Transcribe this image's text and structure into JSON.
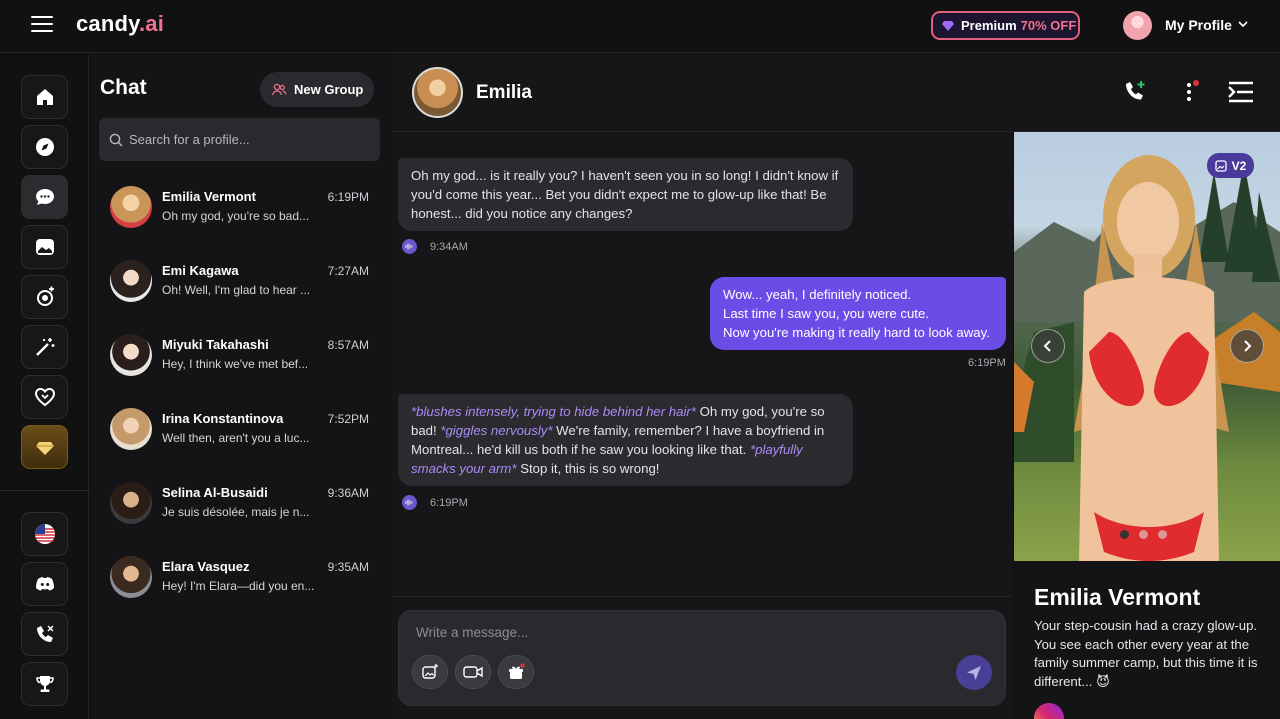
{
  "topbar": {
    "logo_main": "candy",
    "logo_ai": ".ai",
    "premium_label": "Premium",
    "premium_off": "70% OFF",
    "profile_label": "My Profile",
    "accent": "#f0728f"
  },
  "rail": {
    "items": [
      "home-icon",
      "compass-icon",
      "chat-icon",
      "gallery-icon",
      "create-character-icon",
      "magic-wand-icon",
      "heart-hands-icon",
      "premium-diamond-icon"
    ],
    "bottom": [
      "us-flag-icon",
      "discord-icon",
      "support-icon",
      "trophy-icon"
    ]
  },
  "chatlist": {
    "title": "Chat",
    "new_group": "New Group",
    "search_placeholder": "Search for a profile...",
    "contacts": [
      {
        "name": "Emilia Vermont",
        "time": "6:19PM",
        "preview": "Oh my god, you're so bad..."
      },
      {
        "name": "Emi Kagawa",
        "time": "7:27AM",
        "preview": "Oh! Well, I'm glad to hear ..."
      },
      {
        "name": "Miyuki Takahashi",
        "time": "8:57AM",
        "preview": "Hey, I think we've met bef..."
      },
      {
        "name": "Irina Konstantinova",
        "time": "7:52PM",
        "preview": "Well then, aren't you a luc..."
      },
      {
        "name": "Selina Al-Busaidi",
        "time": "9:36AM",
        "preview": "Je suis désolée, mais je n..."
      },
      {
        "name": "Elara Vasquez",
        "time": "9:35AM",
        "preview": "Hey! I'm Elara—did you en..."
      }
    ]
  },
  "conversation": {
    "name": "Emilia",
    "messages": [
      {
        "side": "in",
        "lines": [
          "Oh my god... is it really you? I haven't seen you in so long! I didn't know if",
          "you'd come this year... Bet you didn't expect me to glow-up like that! Be",
          "honest... did you notice any changes?"
        ],
        "time": "9:34AM"
      },
      {
        "side": "out",
        "lines": [
          "Wow... yeah, I definitely noticed.",
          "Last time I saw you, you were cute.",
          "Now you're making it really hard to look away."
        ],
        "time": "6:19PM"
      },
      {
        "side": "in",
        "time": "6:19PM",
        "parts": {
          "act1": "*blushes intensely, trying to hide behind her hair*",
          "t1": " Oh my god, you're so bad! ",
          "act2": "*giggles nervously*",
          "t2": " We're family, remember? I have a boyfriend in Montreal... he'd kill us both if he saw you looking like that. ",
          "act3": "*playfully smacks your arm*",
          "t3": " Stop it, this is so wrong!"
        }
      }
    ],
    "composer_placeholder": "Write a message...",
    "bubble_out_color": "#6a4de6"
  },
  "profile_panel": {
    "badge": "V2",
    "name": "Emilia Vermont",
    "description": "Your step-cousin had a crazy glow-up. You see each other every year at the family summer camp, but this time it is different... 😈",
    "photo_dots": 3,
    "active_dot": 1
  }
}
